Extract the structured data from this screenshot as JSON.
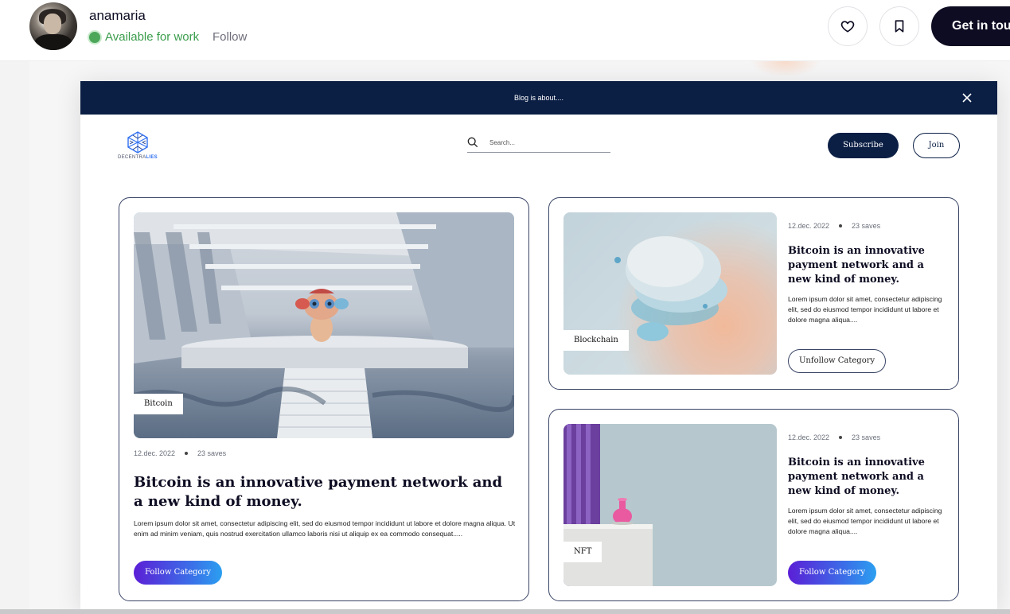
{
  "profile": {
    "username": "anamaria",
    "status": "Available for work",
    "follow_label": "Follow",
    "cta_label": "Get in touch"
  },
  "icons": {
    "like": "heart-icon",
    "save": "bookmark-icon",
    "close": "close-icon",
    "search": "search-icon"
  },
  "colors": {
    "navy": "#0b1f45",
    "available_green": "#3b9d4c",
    "button_gradient_start": "#5b1fd6",
    "button_gradient_end": "#2b9ff0"
  },
  "blog": {
    "announcement": "Blog is about....",
    "logo_text_main": "DECENTRA",
    "logo_text_accent": "LIES",
    "search_placeholder": "Search...",
    "subscribe_label": "Subscribe",
    "join_label": "Join",
    "featured": {
      "tag": "Bitcoin",
      "date": "12.dec. 2022",
      "saves": "23 saves",
      "title": "Bitcoin is an innovative payment network and a new kind of money.",
      "body": "Lorem ipsum dolor sit amet, consectetur adipiscing elit, sed do eiusmod tempor incididunt ut labore et dolore magna aliqua. Ut enim ad minim veniam, quis nostrud exercitation ullamco laboris nisi ut aliquip ex ea commodo consequat.....",
      "button_label": "Follow Category"
    },
    "side_posts": [
      {
        "tag": "Blockchain",
        "date": "12.dec. 2022",
        "saves": "23 saves",
        "title": "Bitcoin is an innovative payment network and a new kind of money.",
        "body": "Lorem ipsum dolor sit amet, consectetur adipiscing elit, sed do eiusmod tempor incididunt ut labore et dolore magna aliqua....",
        "button_label": "Unfollow Category"
      },
      {
        "tag": "NFT",
        "date": "12.dec. 2022",
        "saves": "23 saves",
        "title": "Bitcoin is an innovative payment network and a new kind of money.",
        "body": "Lorem ipsum dolor sit amet, consectetur adipiscing elit, sed do eiusmod tempor incididunt ut labore et dolore magna aliqua....",
        "button_label": "Follow Category"
      }
    ]
  }
}
